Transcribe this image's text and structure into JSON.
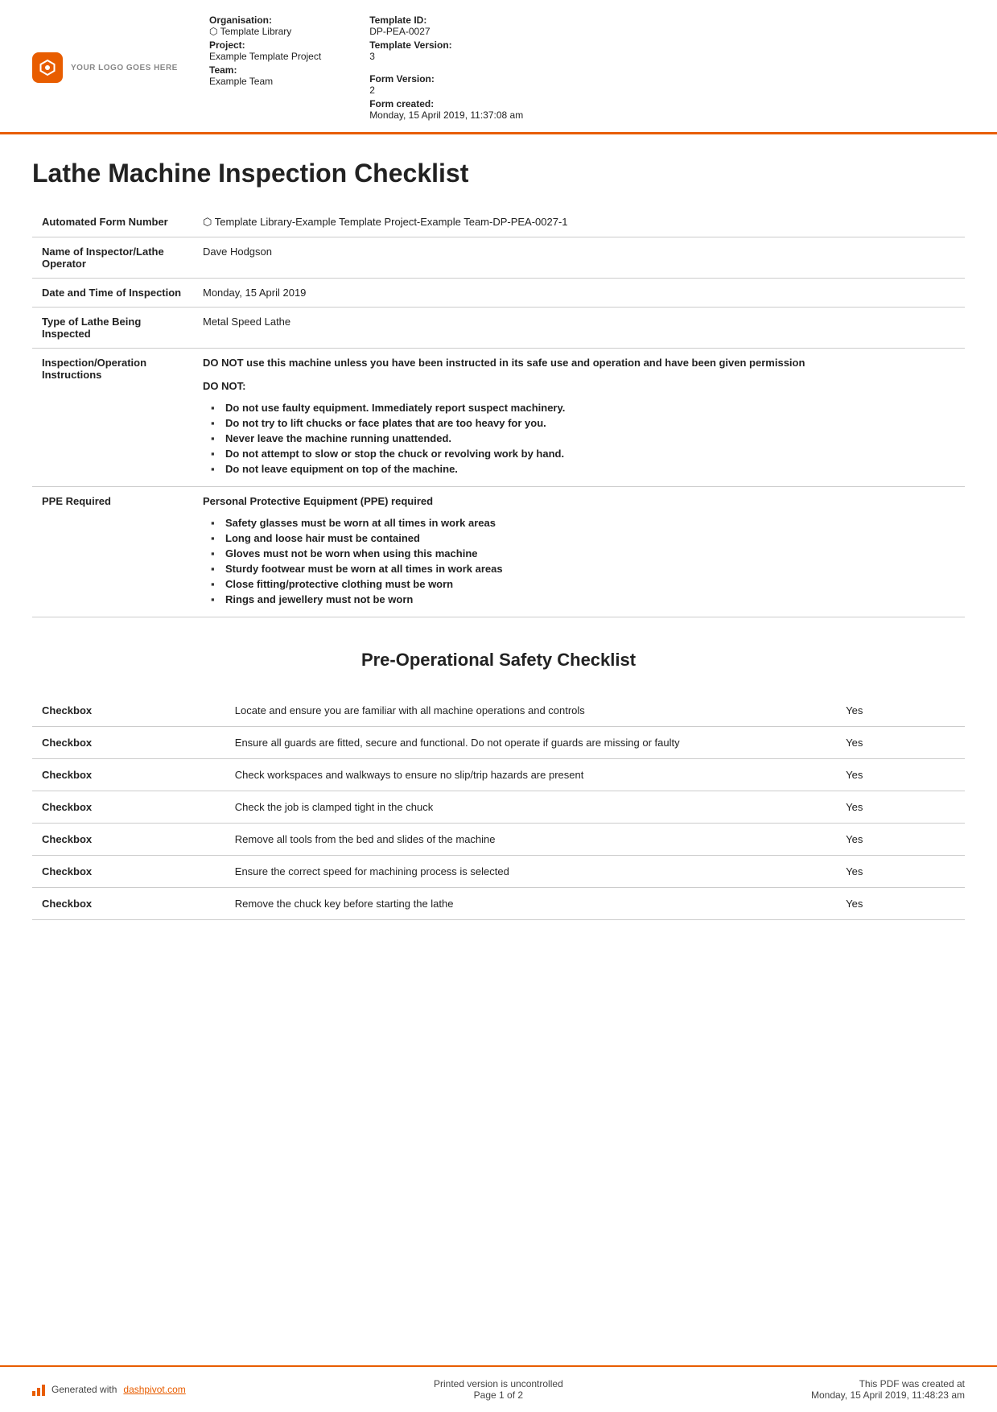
{
  "header": {
    "logo_text": "YOUR LOGO GOES HERE",
    "org_label": "Organisation:",
    "org_value": "⬡ Template Library",
    "project_label": "Project:",
    "project_value": "Example Template Project",
    "team_label": "Team:",
    "team_value": "Example Team",
    "template_id_label": "Template ID:",
    "template_id_value": "DP-PEA-0027",
    "template_version_label": "Template Version:",
    "template_version_value": "3",
    "form_version_label": "Form Version:",
    "form_version_value": "2",
    "form_created_label": "Form created:",
    "form_created_value": "Monday, 15 April 2019, 11:37:08 am"
  },
  "doc": {
    "title": "Lathe Machine Inspection Checklist",
    "fields": [
      {
        "label": "Automated Form Number",
        "value": "⬡ Template Library-Example Template Project-Example Team-DP-PEA-0027-1"
      },
      {
        "label": "Name of Inspector/Lathe Operator",
        "value": "Dave Hodgson"
      },
      {
        "label": "Date and Time of Inspection",
        "value": "Monday, 15 April 2019"
      },
      {
        "label": "Type of Lathe Being Inspected",
        "value": "Metal Speed Lathe"
      },
      {
        "label": "Inspection/Operation Instructions",
        "bold_intro": "DO NOT use this machine unless you have been instructed in its safe use and operation and have been given permission",
        "do_not_header": "DO NOT:",
        "bullets": [
          "Do not use faulty equipment. Immediately report suspect machinery.",
          "Do not try to lift chucks or face plates that are too heavy for you.",
          "Never leave the machine running unattended.",
          "Do not attempt to slow or stop the chuck or revolving work by hand.",
          "Do not leave equipment on top of the machine."
        ]
      },
      {
        "label": "PPE Required",
        "bold_intro": "Personal Protective Equipment (PPE) required",
        "ppe_bullets": [
          "Safety glasses must be worn at all times in work areas",
          "Long and loose hair must be contained",
          "Gloves must not be worn when using this machine",
          "Sturdy footwear must be worn at all times in work areas",
          "Close fitting/protective clothing must be worn",
          "Rings and jewellery must not be worn"
        ]
      }
    ],
    "checklist_section_title": "Pre-Operational Safety Checklist",
    "checklist_col1": "Checkbox",
    "checklist_items": [
      {
        "label": "Checkbox",
        "description": "Locate and ensure you are familiar with all machine operations and controls",
        "value": "Yes"
      },
      {
        "label": "Checkbox",
        "description": "Ensure all guards are fitted, secure and functional. Do not operate if guards are missing or faulty",
        "value": "Yes"
      },
      {
        "label": "Checkbox",
        "description": "Check workspaces and walkways to ensure no slip/trip hazards are present",
        "value": "Yes"
      },
      {
        "label": "Checkbox",
        "description": "Check the job is clamped tight in the chuck",
        "value": "Yes"
      },
      {
        "label": "Checkbox",
        "description": "Remove all tools from the bed and slides of the machine",
        "value": "Yes"
      },
      {
        "label": "Checkbox",
        "description": "Ensure the correct speed for machining process is selected",
        "value": "Yes"
      },
      {
        "label": "Checkbox",
        "description": "Remove the chuck key before starting the lathe",
        "value": "Yes"
      }
    ]
  },
  "footer": {
    "generated_text": "Generated with ",
    "link_text": "dashpivot.com",
    "center_line1": "Printed version is uncontrolled",
    "center_line2": "Page 1 of 2",
    "right_line1": "This PDF was created at",
    "right_line2": "Monday, 15 April 2019, 11:48:23 am"
  }
}
